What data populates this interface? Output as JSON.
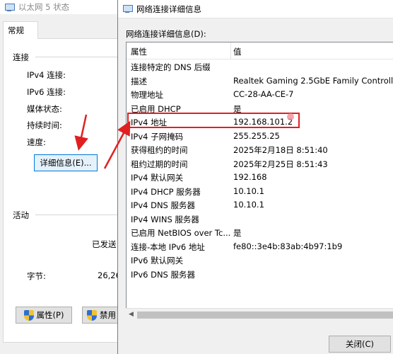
{
  "background_dialog": {
    "title": "以太网 5 状态",
    "tab_general": "常规",
    "section_connection": "连接",
    "connection_rows": [
      "IPv4 连接:",
      "IPv6 连接:",
      "媒体状态:",
      "持续时间:",
      "速度:"
    ],
    "details_button": "详细信息(E)...",
    "section_activity": "活动",
    "sent_label": "已发送",
    "bytes_label": "字节:",
    "bytes_sent": "26,26",
    "properties_button": "属性(P)",
    "disable_button": "禁用"
  },
  "details_dialog": {
    "title": "网络连接详细信息",
    "heading": "网络连接详细信息(D):",
    "col_property": "属性",
    "col_value": "值",
    "rows": [
      {
        "property": "连接特定的 DNS 后缀",
        "value": ""
      },
      {
        "property": "描述",
        "value": "Realtek Gaming 2.5GbE Family Controlle"
      },
      {
        "property": "物理地址",
        "value": "CC-28-AA-CE-7"
      },
      {
        "property": "已启用 DHCP",
        "value": "是"
      },
      {
        "property": "IPv4 地址",
        "value": "192.168.101.2"
      },
      {
        "property": "IPv4 子网掩码",
        "value": "255.255.25"
      },
      {
        "property": "获得租约的时间",
        "value": "2025年2月18日 8:51:40"
      },
      {
        "property": "租约过期的时间",
        "value": "2025年2月25日 8:51:43"
      },
      {
        "property": "IPv4 默认网关",
        "value": "192.168"
      },
      {
        "property": "IPv4 DHCP 服务器",
        "value": "10.10.1"
      },
      {
        "property": "IPv4 DNS 服务器",
        "value": "10.10.1"
      },
      {
        "property": "IPv4 WINS 服务器",
        "value": ""
      },
      {
        "property": "已启用 NetBIOS over Tc...",
        "value": "是"
      },
      {
        "property": "连接-本地 IPv6 地址",
        "value": "fe80::3e4b:83ab:4b97:1b9"
      },
      {
        "property": "IPv6 默认网关",
        "value": ""
      },
      {
        "property": "IPv6 DNS 服务器",
        "value": ""
      }
    ],
    "close_button": "关闭(C)"
  },
  "colors": {
    "annotation_red": "#e02020",
    "focus_blue": "#0078d7",
    "dialog_bg": "#f0f0f0"
  },
  "icons": [
    "network-adapter-icon",
    "uac-shield-icon",
    "scroll-left-arrow-icon"
  ]
}
